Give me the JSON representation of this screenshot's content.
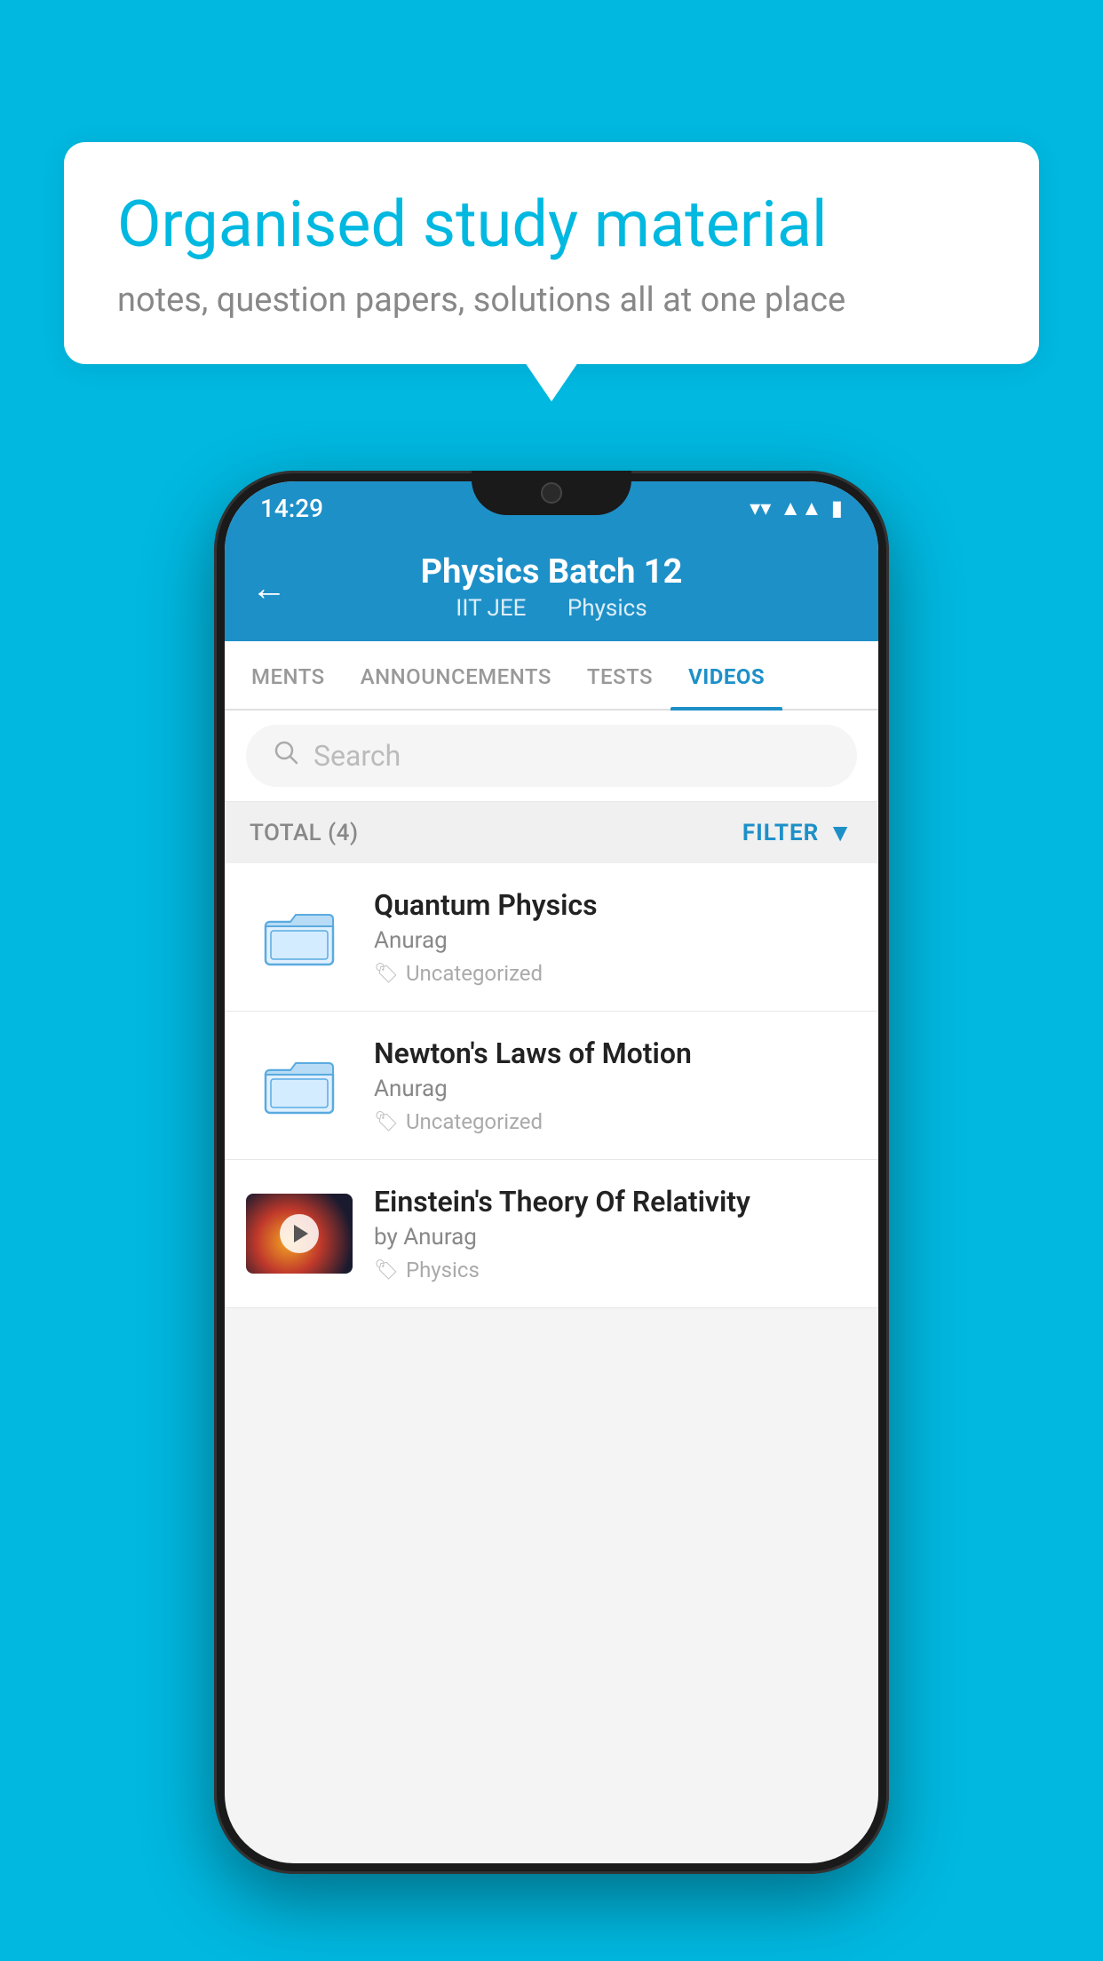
{
  "background_color": "#00b8e0",
  "speech_bubble": {
    "title": "Organised study material",
    "subtitle": "notes, question papers, solutions all at one place"
  },
  "status_bar": {
    "time": "14:29",
    "icons": [
      "wifi",
      "signal",
      "battery"
    ]
  },
  "app_header": {
    "back_label": "←",
    "title": "Physics Batch 12",
    "subtitle_part1": "IIT JEE",
    "subtitle_part2": "Physics"
  },
  "tabs": [
    {
      "label": "MENTS",
      "active": false
    },
    {
      "label": "ANNOUNCEMENTS",
      "active": false
    },
    {
      "label": "TESTS",
      "active": false
    },
    {
      "label": "VIDEOS",
      "active": true
    }
  ],
  "search": {
    "placeholder": "Search"
  },
  "filter_row": {
    "total_label": "TOTAL (4)",
    "filter_label": "FILTER"
  },
  "video_items": [
    {
      "id": "1",
      "title": "Quantum Physics",
      "author": "Anurag",
      "tag": "Uncategorized",
      "type": "folder",
      "has_thumb": false
    },
    {
      "id": "2",
      "title": "Newton's Laws of Motion",
      "author": "Anurag",
      "tag": "Uncategorized",
      "type": "folder",
      "has_thumb": false
    },
    {
      "id": "3",
      "title": "Einstein's Theory Of Relativity",
      "author": "by Anurag",
      "tag": "Physics",
      "type": "video",
      "has_thumb": true
    }
  ]
}
